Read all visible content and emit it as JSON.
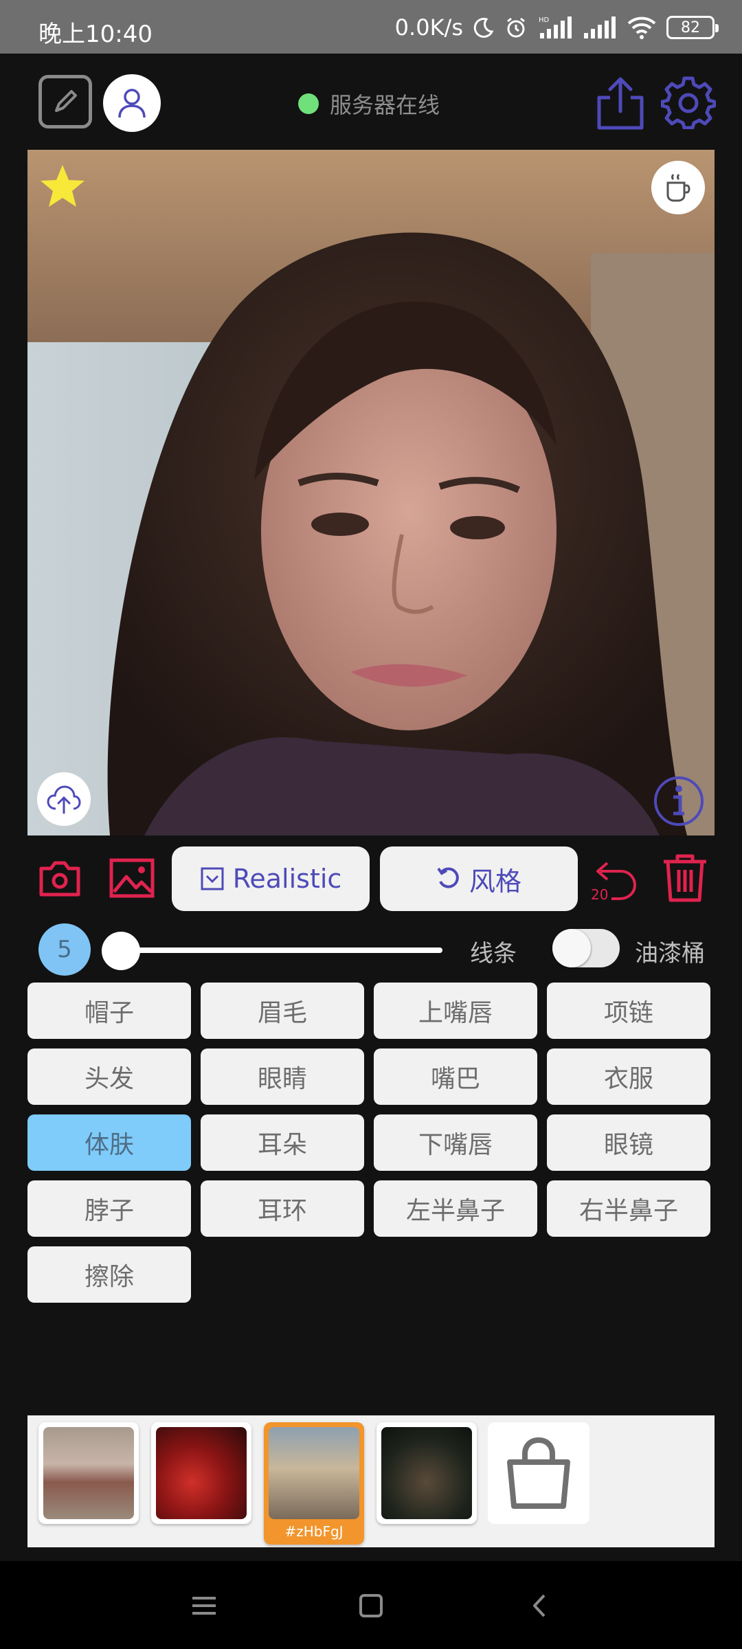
{
  "status_bar": {
    "time": "晚上10:40",
    "network_speed": "0.0K/s",
    "battery": "82",
    "icons": [
      "moon-icon",
      "alarm-icon",
      "hd-signal-icon",
      "signal-icon",
      "wifi-icon",
      "battery-icon"
    ]
  },
  "top_bar": {
    "server_status": "服务器在线",
    "server_status_color": "#6fe07a",
    "icons": [
      "edit-icon",
      "user-icon",
      "share-icon",
      "settings-icon"
    ],
    "accent": "#4e4ab9"
  },
  "canvas": {
    "icons": [
      "star-icon",
      "coffee-icon",
      "cloud-upload-icon",
      "info-icon"
    ]
  },
  "actions": {
    "model_label": "Realistic",
    "style_label": "风格",
    "undo_count": "20",
    "danger_color": "#e0234e",
    "icons": [
      "camera-icon",
      "image-icon",
      "undo-icon",
      "trash-icon"
    ]
  },
  "brush": {
    "size": "5",
    "line_label": "线条",
    "bucket_label": "油漆桶",
    "bucket_enabled": false
  },
  "categories": [
    {
      "label": "帽子",
      "active": false
    },
    {
      "label": "眉毛",
      "active": false
    },
    {
      "label": "上嘴唇",
      "active": false
    },
    {
      "label": "项链",
      "active": false
    },
    {
      "label": "头发",
      "active": false
    },
    {
      "label": "眼睛",
      "active": false
    },
    {
      "label": "嘴巴",
      "active": false
    },
    {
      "label": "衣服",
      "active": false
    },
    {
      "label": "体肤",
      "active": true
    },
    {
      "label": "耳朵",
      "active": false
    },
    {
      "label": "下嘴唇",
      "active": false
    },
    {
      "label": "眼镜",
      "active": false
    },
    {
      "label": "脖子",
      "active": false
    },
    {
      "label": "耳环",
      "active": false
    },
    {
      "label": "左半鼻子",
      "active": false
    },
    {
      "label": "右半鼻子",
      "active": false
    },
    {
      "label": "擦除",
      "active": false
    }
  ],
  "thumbnails": {
    "selected_caption": "#zHbFgJ",
    "selected_color": "#f1952c",
    "shop_icon": "shopping-bag-icon"
  },
  "nav_bar": {
    "icons": [
      "menu-icon",
      "home-icon",
      "back-icon"
    ]
  }
}
